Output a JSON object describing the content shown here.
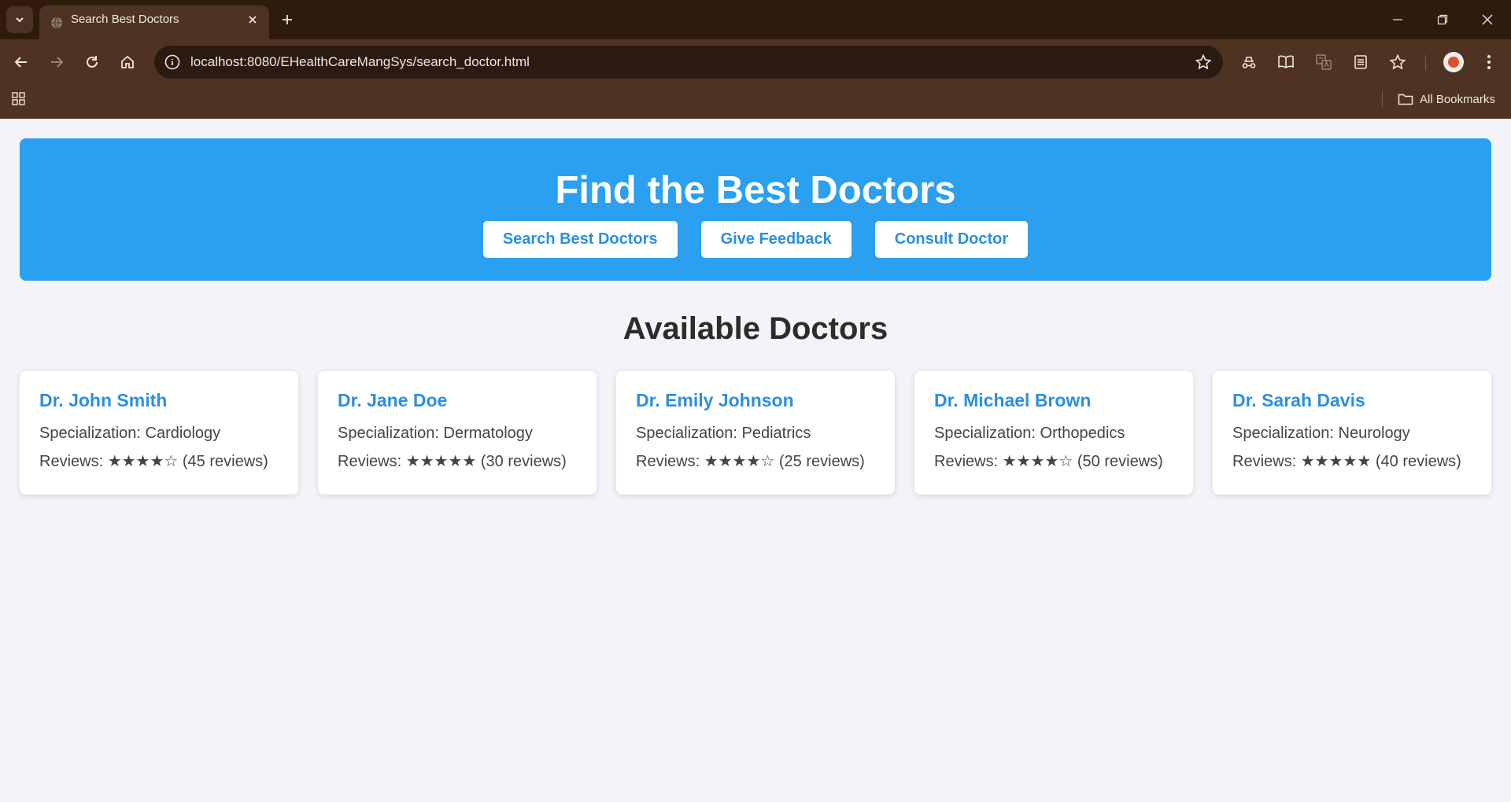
{
  "browser": {
    "tab_title": "Search Best Doctors",
    "url": "localhost:8080/EHealthCareMangSys/search_doctor.html",
    "bookmarks_label": "All Bookmarks"
  },
  "hero": {
    "title": "Find the Best Doctors",
    "buttons": [
      "Search Best Doctors",
      "Give Feedback",
      "Consult Doctor"
    ]
  },
  "section_title": "Available Doctors",
  "doctors": [
    {
      "name": "Dr. John Smith",
      "specialization": "Specialization: Cardiology",
      "reviews": "Reviews: ★★★★☆ (45 reviews)"
    },
    {
      "name": "Dr. Jane Doe",
      "specialization": "Specialization: Dermatology",
      "reviews": "Reviews: ★★★★★ (30 reviews)"
    },
    {
      "name": "Dr. Emily Johnson",
      "specialization": "Specialization: Pediatrics",
      "reviews": "Reviews: ★★★★☆ (25 reviews)"
    },
    {
      "name": "Dr. Michael Brown",
      "specialization": "Specialization: Orthopedics",
      "reviews": "Reviews: ★★★★☆ (50 reviews)"
    },
    {
      "name": "Dr. Sarah Davis",
      "specialization": "Specialization: Neurology",
      "reviews": "Reviews: ★★★★★ (40 reviews)"
    }
  ],
  "colors": {
    "hero_bg": "#2b9ff0",
    "accent": "#2b8fe0",
    "page_bg": "#f4f4f8",
    "chrome_dark": "#2e1b0e",
    "chrome": "#4e3322"
  },
  "icons": [
    "chevron-down-icon",
    "globe-icon",
    "close-icon",
    "plus-icon",
    "minimize-icon",
    "restore-icon",
    "back-icon",
    "forward-icon",
    "reload-icon",
    "home-icon",
    "info-icon",
    "star-icon",
    "extensions-icon",
    "reading-mode-icon",
    "translate-icon",
    "reading-list-icon",
    "bookmarks-star-icon",
    "profile-avatar",
    "more-icon",
    "apps-grid-icon",
    "folder-icon"
  ]
}
